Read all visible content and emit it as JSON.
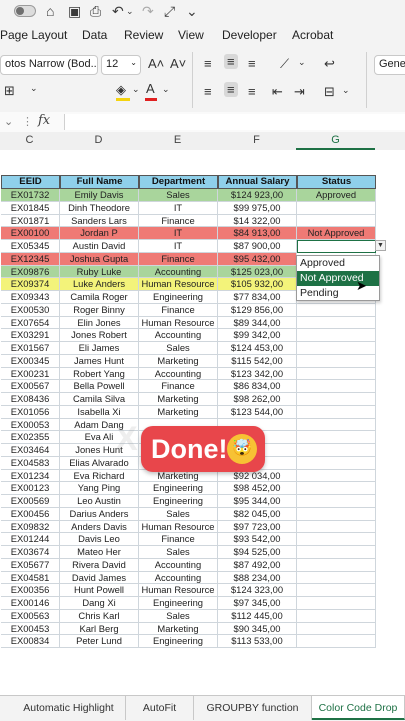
{
  "colors": {
    "header_fill": "#8fd0ea",
    "approved": "#a9d59c",
    "not_approved": "#ef7a75",
    "pending": "#f3f37a",
    "accent": "#1e7145"
  },
  "qat_icons": [
    "toggle-icon",
    "home-icon",
    "save-icon",
    "print-icon",
    "undo-icon",
    "redo-icon",
    "fit-icon",
    "more-icon"
  ],
  "menu": [
    "Page Layout",
    "Data",
    "Review",
    "View",
    "Developer",
    "Acrobat"
  ],
  "ribbon": {
    "font_name": "otos Narrow (Bod...",
    "font_size": "12",
    "format_box": "Gene"
  },
  "fx_label": "fx",
  "columns": [
    "C",
    "D",
    "E",
    "F",
    "G"
  ],
  "headers": [
    "EEID",
    "Full Name",
    "Department",
    "Annual Salary",
    "Status"
  ],
  "rows": [
    [
      "EX01732",
      "Emily Davis",
      "Sales",
      "$124 923,00",
      "Approved",
      "approved"
    ],
    [
      "EX01845",
      "Dinh Theodore",
      "IT",
      "$99 975,00",
      "",
      ""
    ],
    [
      "EX01871",
      "Sanders Lars",
      "Finance",
      "$14 322,00",
      "",
      ""
    ],
    [
      "EX00100",
      "Jordan P",
      "IT",
      "$84 913,00",
      "Not Approved",
      "not_approved"
    ],
    [
      "EX05345",
      "Austin David",
      "IT",
      "$87 900,00",
      "",
      ""
    ],
    [
      "EX12345",
      "Joshua Gupta",
      "Finance",
      "$95 432,00",
      "",
      "not_approved"
    ],
    [
      "EX09876",
      "Ruby Luke",
      "Accounting",
      "$125 023,00",
      "",
      "approved"
    ],
    [
      "EX09374",
      "Luke Anders",
      "Human Resource",
      "$105 932,00",
      "",
      "pending"
    ],
    [
      "EX09343",
      "Camila Roger",
      "Engineering",
      "$77 834,00",
      "",
      ""
    ],
    [
      "EX00530",
      "Roger Binny",
      "Finance",
      "$129 856,00",
      "",
      ""
    ],
    [
      "EX07654",
      "Elin Jones",
      "Human Resource",
      "$89 344,00",
      "",
      ""
    ],
    [
      "EX03291",
      "Jones Robert",
      "Accounting",
      "$99 342,00",
      "",
      ""
    ],
    [
      "EX01567",
      "Eli James",
      "Sales",
      "$124 453,00",
      "",
      ""
    ],
    [
      "EX00345",
      "James Hunt",
      "Marketing",
      "$115 542,00",
      "",
      ""
    ],
    [
      "EX00231",
      "Robert Yang",
      "Accounting",
      "$123 342,00",
      "",
      ""
    ],
    [
      "EX00567",
      "Bella Powell",
      "Finance",
      "$86 834,00",
      "",
      ""
    ],
    [
      "EX08436",
      "Camila Silva",
      "Marketing",
      "$98 262,00",
      "",
      ""
    ],
    [
      "EX01056",
      "Isabella Xi",
      "Marketing",
      "$123 544,00",
      "",
      ""
    ],
    [
      "EX00053",
      "Adam Dang",
      "",
      "",
      "",
      ""
    ],
    [
      "EX02355",
      "Eva Ali",
      "",
      "",
      "",
      ""
    ],
    [
      "EX03464",
      "Jones Hunt",
      "",
      "",
      "",
      ""
    ],
    [
      "EX04583",
      "Elias Alvarado",
      "",
      "",
      "",
      ""
    ],
    [
      "EX01234",
      "Eva Richard",
      "Marketing",
      "$92 034,00",
      "",
      ""
    ],
    [
      "EX00123",
      "Yang Ping",
      "Engineering",
      "$98 452,00",
      "",
      ""
    ],
    [
      "EX00569",
      "Leo Austin",
      "Engineering",
      "$95 344,00",
      "",
      ""
    ],
    [
      "EX00456",
      "Darius Anders",
      "Sales",
      "$82 045,00",
      "",
      ""
    ],
    [
      "EX09832",
      "Anders Davis",
      "Human Resource",
      "$97 723,00",
      "",
      ""
    ],
    [
      "EX01244",
      "Davis Leo",
      "Finance",
      "$93 542,00",
      "",
      ""
    ],
    [
      "EX03674",
      "Mateo Her",
      "Sales",
      "$94 525,00",
      "",
      ""
    ],
    [
      "EX05677",
      "Rivera David",
      "Accounting",
      "$87 492,00",
      "",
      ""
    ],
    [
      "EX04581",
      "David James",
      "Accounting",
      "$88 234,00",
      "",
      ""
    ],
    [
      "EX00356",
      "Hunt Powell",
      "Human Resource",
      "$124 323,00",
      "",
      ""
    ],
    [
      "EX00146",
      "Dang Xi",
      "Engineering",
      "$97 345,00",
      "",
      ""
    ],
    [
      "EX00563",
      "Chris Karl",
      "Sales",
      "$112 445,00",
      "",
      ""
    ],
    [
      "EX00453",
      "Karl Berg",
      "Marketing",
      "$90 345,00",
      "",
      ""
    ],
    [
      "EX00834",
      "Peter Lund",
      "Engineering",
      "$113 533,00",
      "",
      ""
    ]
  ],
  "dropdown": {
    "options": [
      "Approved",
      "Not Approved",
      "Pending"
    ],
    "selected": 1
  },
  "overlay": {
    "text": "Done!",
    "emoji": "🤯"
  },
  "sheet_tabs": [
    "Automatic Highlight",
    "AutoFit",
    "GROUPBY function",
    "Color Code Drop"
  ],
  "active_tab": 3
}
